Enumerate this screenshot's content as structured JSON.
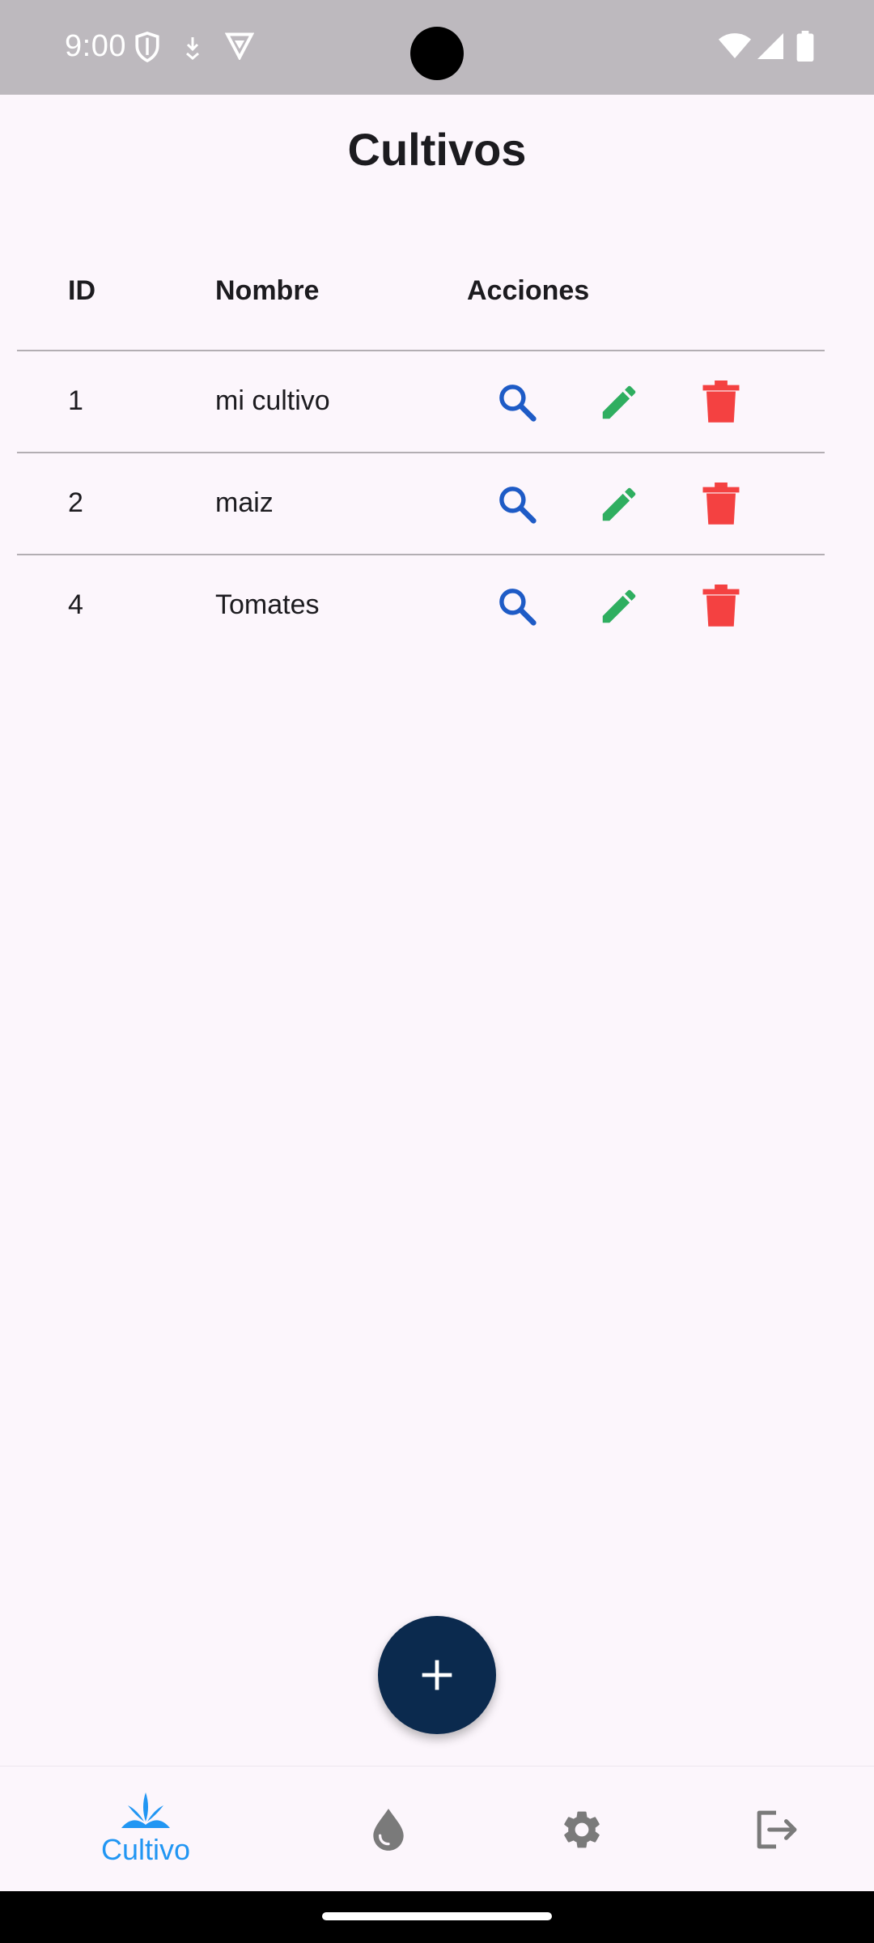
{
  "status_bar": {
    "time": "9:00",
    "icons": [
      "shield-icon",
      "download-icon",
      "vpn-icon",
      "wifi-icon",
      "signal-icon",
      "battery-icon"
    ]
  },
  "header": {
    "title": "Cultivos"
  },
  "table": {
    "columns": [
      "ID",
      "Nombre",
      "Acciones"
    ],
    "rows": [
      {
        "id": "1",
        "nombre": "mi cultivo"
      },
      {
        "id": "2",
        "nombre": "maiz"
      },
      {
        "id": "4",
        "nombre": "Tomates"
      }
    ],
    "actions": [
      "search-icon",
      "edit-icon",
      "delete-icon"
    ]
  },
  "fab": {
    "icon": "plus-icon"
  },
  "bottom_nav": {
    "items": [
      {
        "label": "Cultivo",
        "icon": "plant-icon",
        "active": true
      },
      {
        "label": "",
        "icon": "water-drop-icon",
        "active": false
      },
      {
        "label": "",
        "icon": "gear-icon",
        "active": false
      },
      {
        "label": "",
        "icon": "logout-icon",
        "active": false
      }
    ]
  },
  "colors": {
    "background": "#fcf6fc",
    "status_bar": "#bdb9be",
    "fab": "#0b2a4e",
    "search": "#1e5bc6",
    "edit": "#2fae60",
    "delete": "#f44141",
    "nav_active": "#2196f3",
    "nav_inactive": "#7a7a7a"
  }
}
